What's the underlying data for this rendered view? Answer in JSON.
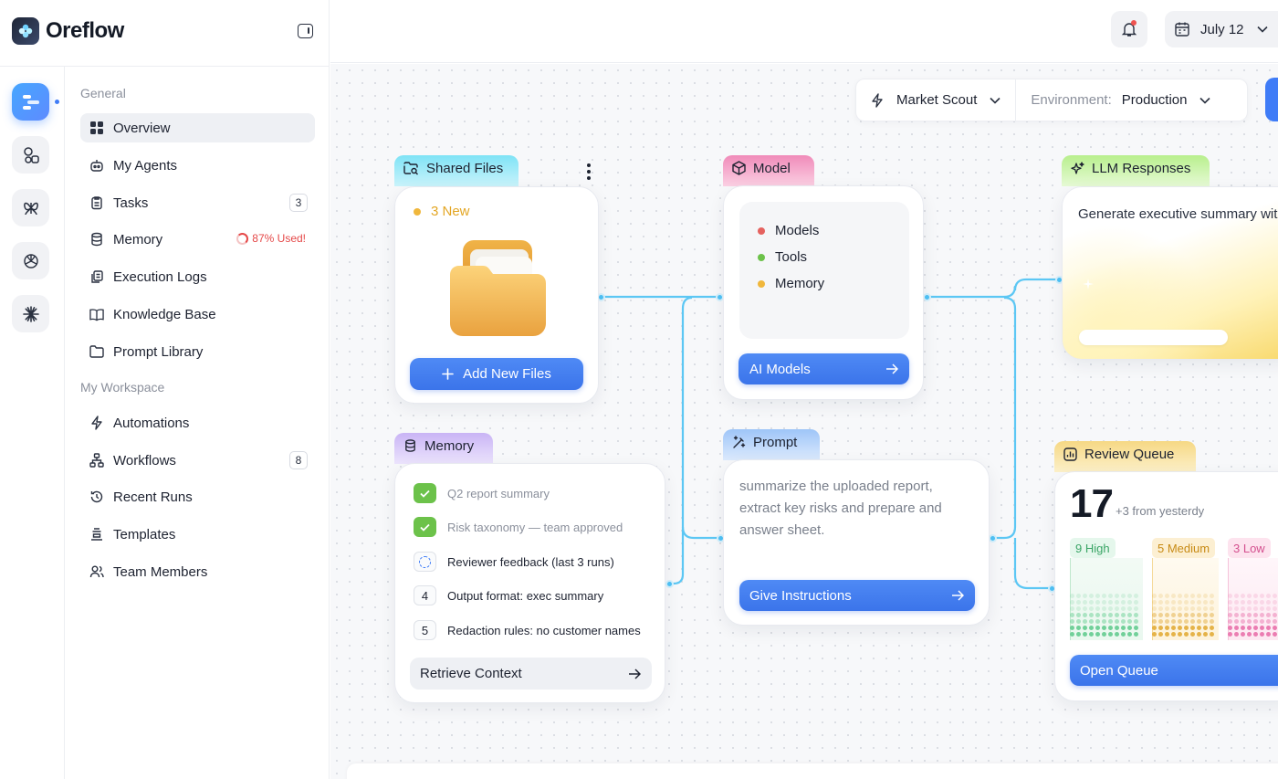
{
  "app": {
    "name": "Oreflow"
  },
  "colors": {
    "accent": "#3f7cf7",
    "success": "#6cc24a",
    "danger": "#e54848",
    "connector": "#4fc3f7"
  },
  "sidebar": {
    "section_general": "General",
    "section_workspace": "My Workspace",
    "items": [
      {
        "label": "Overview",
        "icon": "grid-icon",
        "active": true
      },
      {
        "label": "My Agents",
        "icon": "robot-icon"
      },
      {
        "label": "Tasks",
        "icon": "clipboard-icon",
        "badge": "3"
      },
      {
        "label": "Memory",
        "icon": "database-icon",
        "warning": "87% Used!"
      },
      {
        "label": "Execution Logs",
        "icon": "logs-icon"
      },
      {
        "label": "Knowledge Base",
        "icon": "book-icon"
      },
      {
        "label": "Prompt Library",
        "icon": "folder-icon"
      }
    ],
    "workspace_items": [
      {
        "label": "Automations",
        "icon": "bolt-icon"
      },
      {
        "label": "Workflows",
        "icon": "workflow-icon",
        "badge": "8"
      },
      {
        "label": "Recent Runs",
        "icon": "history-icon"
      },
      {
        "label": "Templates",
        "icon": "templates-icon"
      },
      {
        "label": "Team Members",
        "icon": "team-icon"
      }
    ]
  },
  "topbar": {
    "date": "July 12"
  },
  "selector": {
    "agent": "Market Scout",
    "env_label": "Environment:",
    "env_value": "Production"
  },
  "shared_files": {
    "title": "Shared Files",
    "new_count": "3 New",
    "button": "Add New Files"
  },
  "model": {
    "title": "Model",
    "items": [
      "Models",
      "Tools",
      "Memory"
    ],
    "button": "AI Models"
  },
  "llm": {
    "title": "LLM Responses",
    "text": "Generate executive summary with the key risks and recommend actions"
  },
  "memory": {
    "title": "Memory",
    "rows": [
      {
        "label": "Q2 report summary",
        "state": "done"
      },
      {
        "label": "Risk taxonomy — team approved",
        "state": "done"
      },
      {
        "label": "Reviewer feedback (last 3 runs)",
        "state": "pending"
      },
      {
        "label": "Output format: exec summary",
        "num": "4"
      },
      {
        "label": "Redaction rules: no customer names",
        "num": "5"
      }
    ],
    "button": "Retrieve Context"
  },
  "prompt": {
    "title": "Prompt",
    "text": "summarize the uploaded report, extract key risks and prepare and answer sheet.",
    "button": "Give Instructions"
  },
  "review": {
    "title": "Review Queue",
    "count": "17",
    "delta": "+3 from yesterdy",
    "levels": [
      {
        "label": "9 High",
        "color": "#5cc98a"
      },
      {
        "label": "5 Medium",
        "color": "#e0a72e"
      },
      {
        "label": "3 Low",
        "color": "#e86aa6"
      }
    ],
    "button": "Open Queue"
  }
}
